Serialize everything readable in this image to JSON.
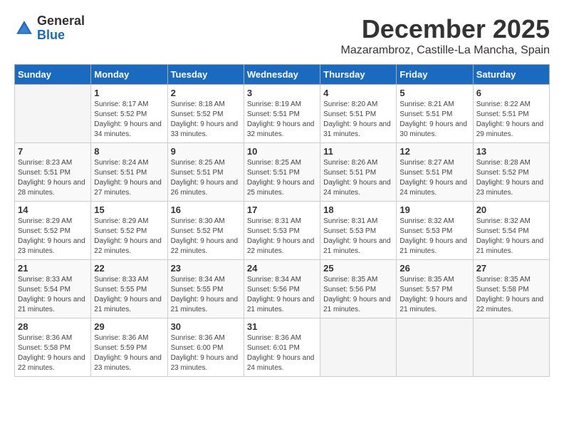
{
  "header": {
    "logo_line1": "General",
    "logo_line2": "Blue",
    "month_title": "December 2025",
    "subtitle": "Mazarambroz, Castille-La Mancha, Spain"
  },
  "calendar": {
    "days_of_week": [
      "Sunday",
      "Monday",
      "Tuesday",
      "Wednesday",
      "Thursday",
      "Friday",
      "Saturday"
    ],
    "weeks": [
      [
        {
          "day": "",
          "empty": true
        },
        {
          "day": "1",
          "sunrise": "Sunrise: 8:17 AM",
          "sunset": "Sunset: 5:52 PM",
          "daylight": "Daylight: 9 hours and 34 minutes."
        },
        {
          "day": "2",
          "sunrise": "Sunrise: 8:18 AM",
          "sunset": "Sunset: 5:52 PM",
          "daylight": "Daylight: 9 hours and 33 minutes."
        },
        {
          "day": "3",
          "sunrise": "Sunrise: 8:19 AM",
          "sunset": "Sunset: 5:51 PM",
          "daylight": "Daylight: 9 hours and 32 minutes."
        },
        {
          "day": "4",
          "sunrise": "Sunrise: 8:20 AM",
          "sunset": "Sunset: 5:51 PM",
          "daylight": "Daylight: 9 hours and 31 minutes."
        },
        {
          "day": "5",
          "sunrise": "Sunrise: 8:21 AM",
          "sunset": "Sunset: 5:51 PM",
          "daylight": "Daylight: 9 hours and 30 minutes."
        },
        {
          "day": "6",
          "sunrise": "Sunrise: 8:22 AM",
          "sunset": "Sunset: 5:51 PM",
          "daylight": "Daylight: 9 hours and 29 minutes."
        }
      ],
      [
        {
          "day": "7",
          "sunrise": "Sunrise: 8:23 AM",
          "sunset": "Sunset: 5:51 PM",
          "daylight": "Daylight: 9 hours and 28 minutes."
        },
        {
          "day": "8",
          "sunrise": "Sunrise: 8:24 AM",
          "sunset": "Sunset: 5:51 PM",
          "daylight": "Daylight: 9 hours and 27 minutes."
        },
        {
          "day": "9",
          "sunrise": "Sunrise: 8:25 AM",
          "sunset": "Sunset: 5:51 PM",
          "daylight": "Daylight: 9 hours and 26 minutes."
        },
        {
          "day": "10",
          "sunrise": "Sunrise: 8:25 AM",
          "sunset": "Sunset: 5:51 PM",
          "daylight": "Daylight: 9 hours and 25 minutes."
        },
        {
          "day": "11",
          "sunrise": "Sunrise: 8:26 AM",
          "sunset": "Sunset: 5:51 PM",
          "daylight": "Daylight: 9 hours and 24 minutes."
        },
        {
          "day": "12",
          "sunrise": "Sunrise: 8:27 AM",
          "sunset": "Sunset: 5:51 PM",
          "daylight": "Daylight: 9 hours and 24 minutes."
        },
        {
          "day": "13",
          "sunrise": "Sunrise: 8:28 AM",
          "sunset": "Sunset: 5:52 PM",
          "daylight": "Daylight: 9 hours and 23 minutes."
        }
      ],
      [
        {
          "day": "14",
          "sunrise": "Sunrise: 8:29 AM",
          "sunset": "Sunset: 5:52 PM",
          "daylight": "Daylight: 9 hours and 23 minutes."
        },
        {
          "day": "15",
          "sunrise": "Sunrise: 8:29 AM",
          "sunset": "Sunset: 5:52 PM",
          "daylight": "Daylight: 9 hours and 22 minutes."
        },
        {
          "day": "16",
          "sunrise": "Sunrise: 8:30 AM",
          "sunset": "Sunset: 5:52 PM",
          "daylight": "Daylight: 9 hours and 22 minutes."
        },
        {
          "day": "17",
          "sunrise": "Sunrise: 8:31 AM",
          "sunset": "Sunset: 5:53 PM",
          "daylight": "Daylight: 9 hours and 22 minutes."
        },
        {
          "day": "18",
          "sunrise": "Sunrise: 8:31 AM",
          "sunset": "Sunset: 5:53 PM",
          "daylight": "Daylight: 9 hours and 21 minutes."
        },
        {
          "day": "19",
          "sunrise": "Sunrise: 8:32 AM",
          "sunset": "Sunset: 5:53 PM",
          "daylight": "Daylight: 9 hours and 21 minutes."
        },
        {
          "day": "20",
          "sunrise": "Sunrise: 8:32 AM",
          "sunset": "Sunset: 5:54 PM",
          "daylight": "Daylight: 9 hours and 21 minutes."
        }
      ],
      [
        {
          "day": "21",
          "sunrise": "Sunrise: 8:33 AM",
          "sunset": "Sunset: 5:54 PM",
          "daylight": "Daylight: 9 hours and 21 minutes."
        },
        {
          "day": "22",
          "sunrise": "Sunrise: 8:33 AM",
          "sunset": "Sunset: 5:55 PM",
          "daylight": "Daylight: 9 hours and 21 minutes."
        },
        {
          "day": "23",
          "sunrise": "Sunrise: 8:34 AM",
          "sunset": "Sunset: 5:55 PM",
          "daylight": "Daylight: 9 hours and 21 minutes."
        },
        {
          "day": "24",
          "sunrise": "Sunrise: 8:34 AM",
          "sunset": "Sunset: 5:56 PM",
          "daylight": "Daylight: 9 hours and 21 minutes."
        },
        {
          "day": "25",
          "sunrise": "Sunrise: 8:35 AM",
          "sunset": "Sunset: 5:56 PM",
          "daylight": "Daylight: 9 hours and 21 minutes."
        },
        {
          "day": "26",
          "sunrise": "Sunrise: 8:35 AM",
          "sunset": "Sunset: 5:57 PM",
          "daylight": "Daylight: 9 hours and 21 minutes."
        },
        {
          "day": "27",
          "sunrise": "Sunrise: 8:35 AM",
          "sunset": "Sunset: 5:58 PM",
          "daylight": "Daylight: 9 hours and 22 minutes."
        }
      ],
      [
        {
          "day": "28",
          "sunrise": "Sunrise: 8:36 AM",
          "sunset": "Sunset: 5:58 PM",
          "daylight": "Daylight: 9 hours and 22 minutes."
        },
        {
          "day": "29",
          "sunrise": "Sunrise: 8:36 AM",
          "sunset": "Sunset: 5:59 PM",
          "daylight": "Daylight: 9 hours and 23 minutes."
        },
        {
          "day": "30",
          "sunrise": "Sunrise: 8:36 AM",
          "sunset": "Sunset: 6:00 PM",
          "daylight": "Daylight: 9 hours and 23 minutes."
        },
        {
          "day": "31",
          "sunrise": "Sunrise: 8:36 AM",
          "sunset": "Sunset: 6:01 PM",
          "daylight": "Daylight: 9 hours and 24 minutes."
        },
        {
          "day": "",
          "empty": true
        },
        {
          "day": "",
          "empty": true
        },
        {
          "day": "",
          "empty": true
        }
      ]
    ]
  }
}
